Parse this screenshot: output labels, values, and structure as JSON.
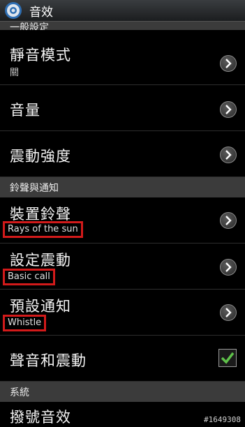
{
  "titlebar": {
    "title": "音效",
    "icon": "gear-icon"
  },
  "sections": {
    "general": "一般設定",
    "ringtones": "鈴聲與通知",
    "system": "系統"
  },
  "rows": {
    "silent_mode": {
      "label": "靜音模式",
      "value": "關"
    },
    "volume": {
      "label": "音量"
    },
    "vibration_intensity": {
      "label": "震動強度"
    },
    "device_ringtone": {
      "label": "裝置鈴聲",
      "value": "Rays of the sun"
    },
    "vibration": {
      "label": "設定震動",
      "value": "Basic call"
    },
    "default_notification": {
      "label": "預設通知",
      "value": "Whistle"
    },
    "sound_and_vibrate": {
      "label": "聲音和震動",
      "checked": true
    },
    "dialing_sounds": {
      "label": "撥號音效"
    }
  },
  "watermark": "#1649308",
  "colors": {
    "highlight_box": "#d21a1a",
    "checkmark": "#5fc24a"
  }
}
